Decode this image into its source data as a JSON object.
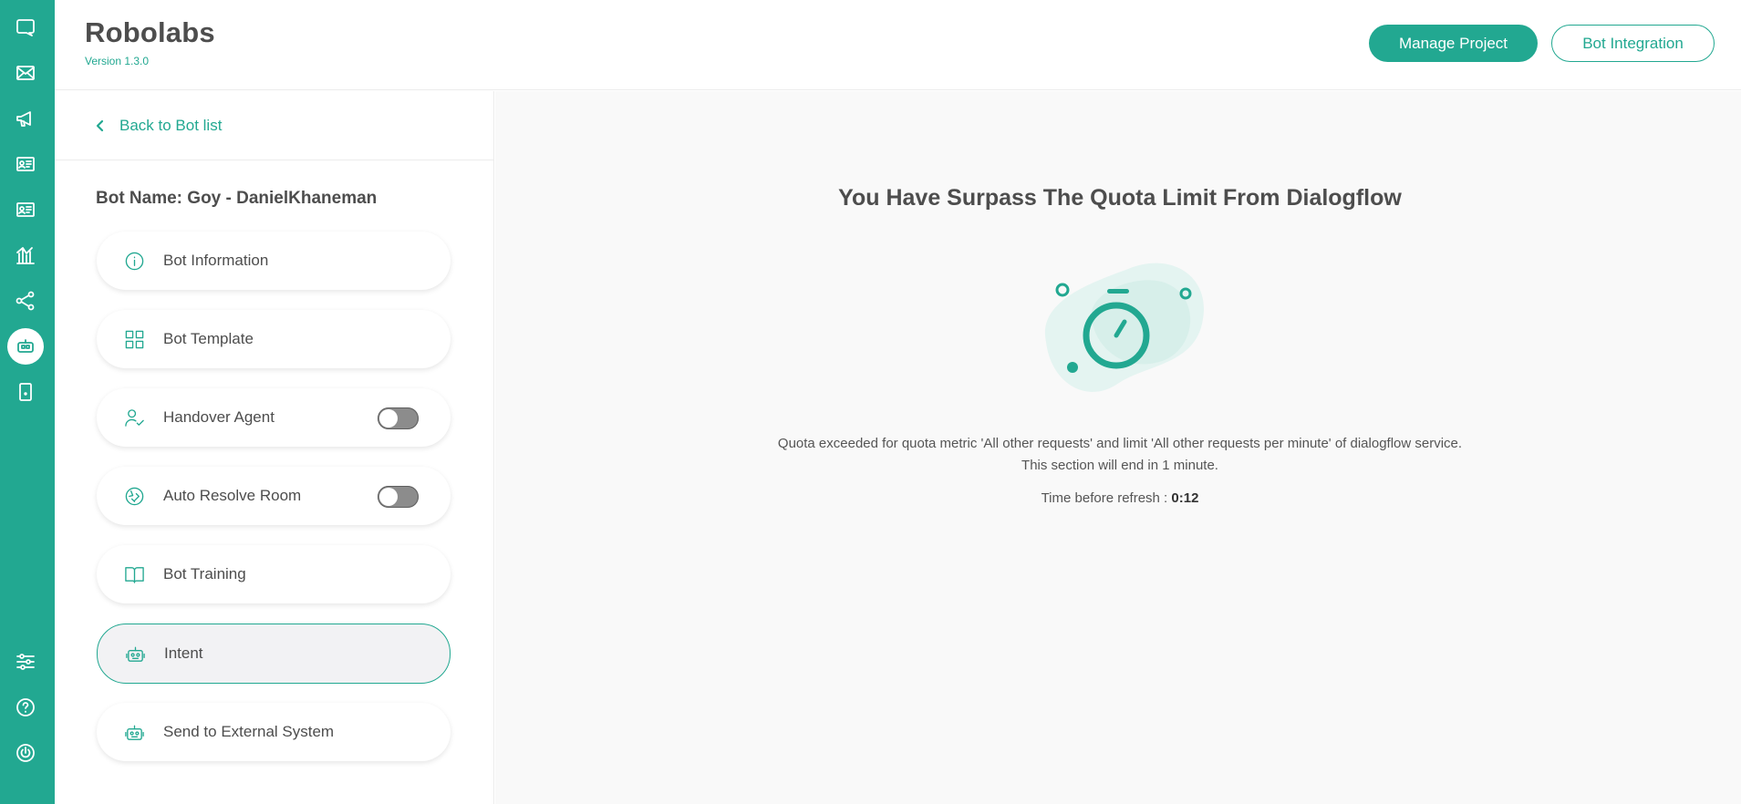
{
  "header": {
    "app_title": "Robolabs",
    "version": "Version 1.3.0",
    "manage_project_label": "Manage Project",
    "bot_integration_label": "Bot Integration"
  },
  "rail": {
    "items": [
      {
        "icon": "chat-icon"
      },
      {
        "icon": "mail-icon"
      },
      {
        "icon": "megaphone-icon"
      },
      {
        "icon": "contact-card-icon"
      },
      {
        "icon": "contact-card-icon"
      },
      {
        "icon": "analytics-icon"
      },
      {
        "icon": "share-nodes-icon"
      },
      {
        "icon": "bot-icon",
        "active": true
      },
      {
        "icon": "tablet-icon"
      },
      {
        "icon": "sliders-icon"
      },
      {
        "icon": "help-icon"
      },
      {
        "icon": "power-icon"
      }
    ]
  },
  "side": {
    "back_label": "Back to Bot list",
    "bot_name": "Bot Name: Goy - DanielKhaneman",
    "items": [
      {
        "label": "Bot Information",
        "icon": "info-icon"
      },
      {
        "label": "Bot Template",
        "icon": "grid-icon"
      },
      {
        "label": "Handover Agent",
        "icon": "user-check-icon",
        "toggle": false
      },
      {
        "label": "Auto Resolve Room",
        "icon": "auto-resolve-icon",
        "toggle": false
      },
      {
        "label": "Bot Training",
        "icon": "book-icon"
      },
      {
        "label": "Intent",
        "icon": "robot-icon",
        "active": true
      },
      {
        "label": "Send to External System",
        "icon": "robot-icon"
      }
    ]
  },
  "main": {
    "title": "You Have Surpass The Quota Limit From Dialogflow",
    "message_line1": "Quota exceeded for quota metric 'All other requests' and limit 'All other requests per minute' of dialogflow service.",
    "message_line2": "This section will end in 1 minute.",
    "refresh_label": "Time before refresh : ",
    "refresh_value": "0:12",
    "illustration_icon": "stopwatch-icon"
  },
  "colors": {
    "brand": "#22a891",
    "main_bg": "#f9f9f9"
  }
}
